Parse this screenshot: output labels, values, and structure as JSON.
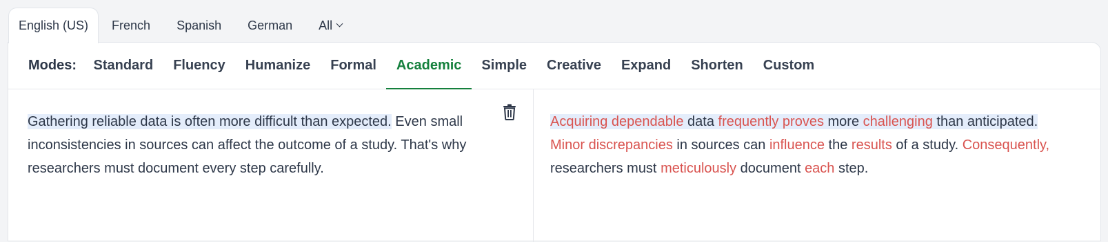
{
  "languages": {
    "tabs": [
      "English (US)",
      "French",
      "Spanish",
      "German",
      "All"
    ],
    "active": "English (US)"
  },
  "modes": {
    "label": "Modes:",
    "items": [
      "Standard",
      "Fluency",
      "Humanize",
      "Formal",
      "Academic",
      "Simple",
      "Creative",
      "Expand",
      "Shorten",
      "Custom"
    ],
    "active": "Academic"
  },
  "input": {
    "highlighted_sentence": "Gathering reliable data is often more difficult than expected.",
    "rest": "Even small inconsistencies in sources can affect the outcome of a study. That's why researchers must document every step carefully."
  },
  "output": {
    "segments": [
      {
        "text": "Acquiring dependable",
        "changed": true,
        "hl": true
      },
      {
        "text": " data ",
        "changed": false,
        "hl": true
      },
      {
        "text": "frequently proves",
        "changed": true,
        "hl": true
      },
      {
        "text": " more ",
        "changed": false,
        "hl": true
      },
      {
        "text": "challenging",
        "changed": true,
        "hl": true
      },
      {
        "text": " than anticipated.",
        "changed": false,
        "hl": true
      },
      {
        "text": " ",
        "changed": false,
        "hl": false
      },
      {
        "text": "Minor discrepancies",
        "changed": true,
        "hl": false
      },
      {
        "text": " in sources can ",
        "changed": false,
        "hl": false
      },
      {
        "text": "influence",
        "changed": true,
        "hl": false
      },
      {
        "text": " the ",
        "changed": false,
        "hl": false
      },
      {
        "text": "results",
        "changed": true,
        "hl": false
      },
      {
        "text": " of a study. ",
        "changed": false,
        "hl": false
      },
      {
        "text": "Consequently,",
        "changed": true,
        "hl": false
      },
      {
        "text": " researchers must ",
        "changed": false,
        "hl": false
      },
      {
        "text": "meticulously",
        "changed": true,
        "hl": false
      },
      {
        "text": " document ",
        "changed": false,
        "hl": false
      },
      {
        "text": "each",
        "changed": true,
        "hl": false
      },
      {
        "text": " step.",
        "changed": false,
        "hl": false
      }
    ]
  },
  "colors": {
    "accent": "#15803d",
    "changed_word": "#d9534f",
    "sentence_highlight": "#e4edfb"
  },
  "icons": {
    "clear": "trash-icon",
    "dropdown": "chevron-down-icon"
  }
}
